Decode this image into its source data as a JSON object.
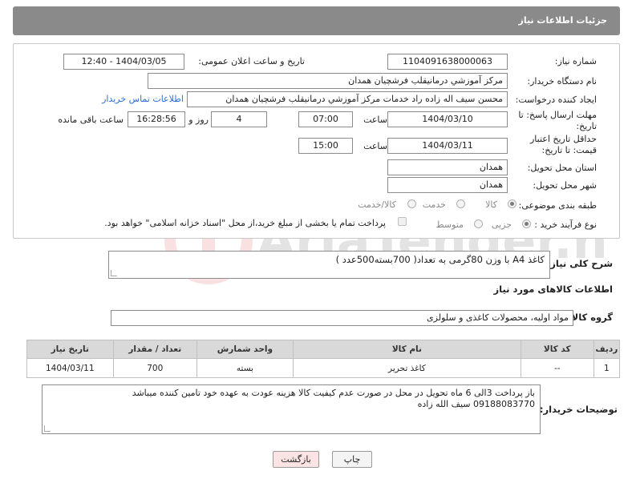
{
  "header": {
    "title": "جزئیات اطلاعات نیاز"
  },
  "form": {
    "need_number_label": "شماره نیاز:",
    "need_number": "1104091638000063",
    "announce_label": "تاریخ و ساعت اعلان عمومی:",
    "announce_value": "1404/03/05 - 12:40",
    "buyer_org_label": "نام دستگاه خریدار:",
    "buyer_org": "مرکز آموزشي درمانيقلب فرشچيان همدان",
    "requester_label": "ایجاد کننده درخواست:",
    "requester": "محسن سیف اله زاده راد خدمات مرکز آموزشي درمانيقلب فرشچيان همدان",
    "contact_link": "اطلاعات تماس خریدار",
    "deadline_label": "مهلت ارسال پاسخ: تا تاریخ:",
    "deadline_date": "1404/03/10",
    "time_label": "ساعت",
    "deadline_time": "07:00",
    "days_value": "4",
    "days_label": "روز و",
    "remaining_time": "16:28:56",
    "remaining_label": "ساعت باقی مانده",
    "price_validity_label": "حداقل تاریخ اعتبار قیمت: تا تاریخ:",
    "price_date": "1404/03/11",
    "price_time": "15:00",
    "province_label": "استان محل تحویل:",
    "province": "همدان",
    "city_label": "شهر محل تحویل:",
    "city": "همدان",
    "category_label": "طبقه بندی موضوعی:",
    "category_options": [
      "کالا",
      "خدمت",
      "کالا/خدمت"
    ],
    "process_label": "نوع فرآیند خرید :",
    "process_options": [
      "جزیی",
      "متوسط"
    ],
    "payment_note": "پرداخت تمام یا بخشی از مبلغ خرید،از محل \"اسناد خزانه اسلامی\" خواهد بود."
  },
  "summary": {
    "label": "شرح کلی نیاز:",
    "text": "کاغذ A4 با وزن 80گرمی  به تعداد( 700بسته500عدد )"
  },
  "goods": {
    "section_title": "اطلاعات کالاهای مورد نیاز",
    "group_label": "گروه کالا:",
    "group_value": "مواد اولیه، محصولات کاغذی و سلولزی",
    "columns": [
      "ردیف",
      "کد کالا",
      "نام کالا",
      "واحد شمارش",
      "تعداد / مقدار",
      "تاریخ نیاز"
    ],
    "rows": [
      {
        "index": "1",
        "code": "--",
        "name": "کاغذ تحریر",
        "unit": "بسته",
        "qty": "700",
        "date": "1404/03/11"
      }
    ]
  },
  "buyer_notes": {
    "label": "توضیحات خریدار:",
    "line1": "باز پرداخت 3الی 6 ماه تحویل در محل در صورت عدم کیفیت کالا هزینه عودت به عهده خود تامین کننده میباشد",
    "line2": "09188083770 سیف الله زاده"
  },
  "buttons": {
    "print": "چاپ",
    "back": "بازگشت"
  },
  "colors": {
    "header_bg": "#8a8a8a",
    "table_header_bg": "#d9d9d9",
    "link": "#2a6fd6",
    "back_bg": "#fde4e4"
  }
}
